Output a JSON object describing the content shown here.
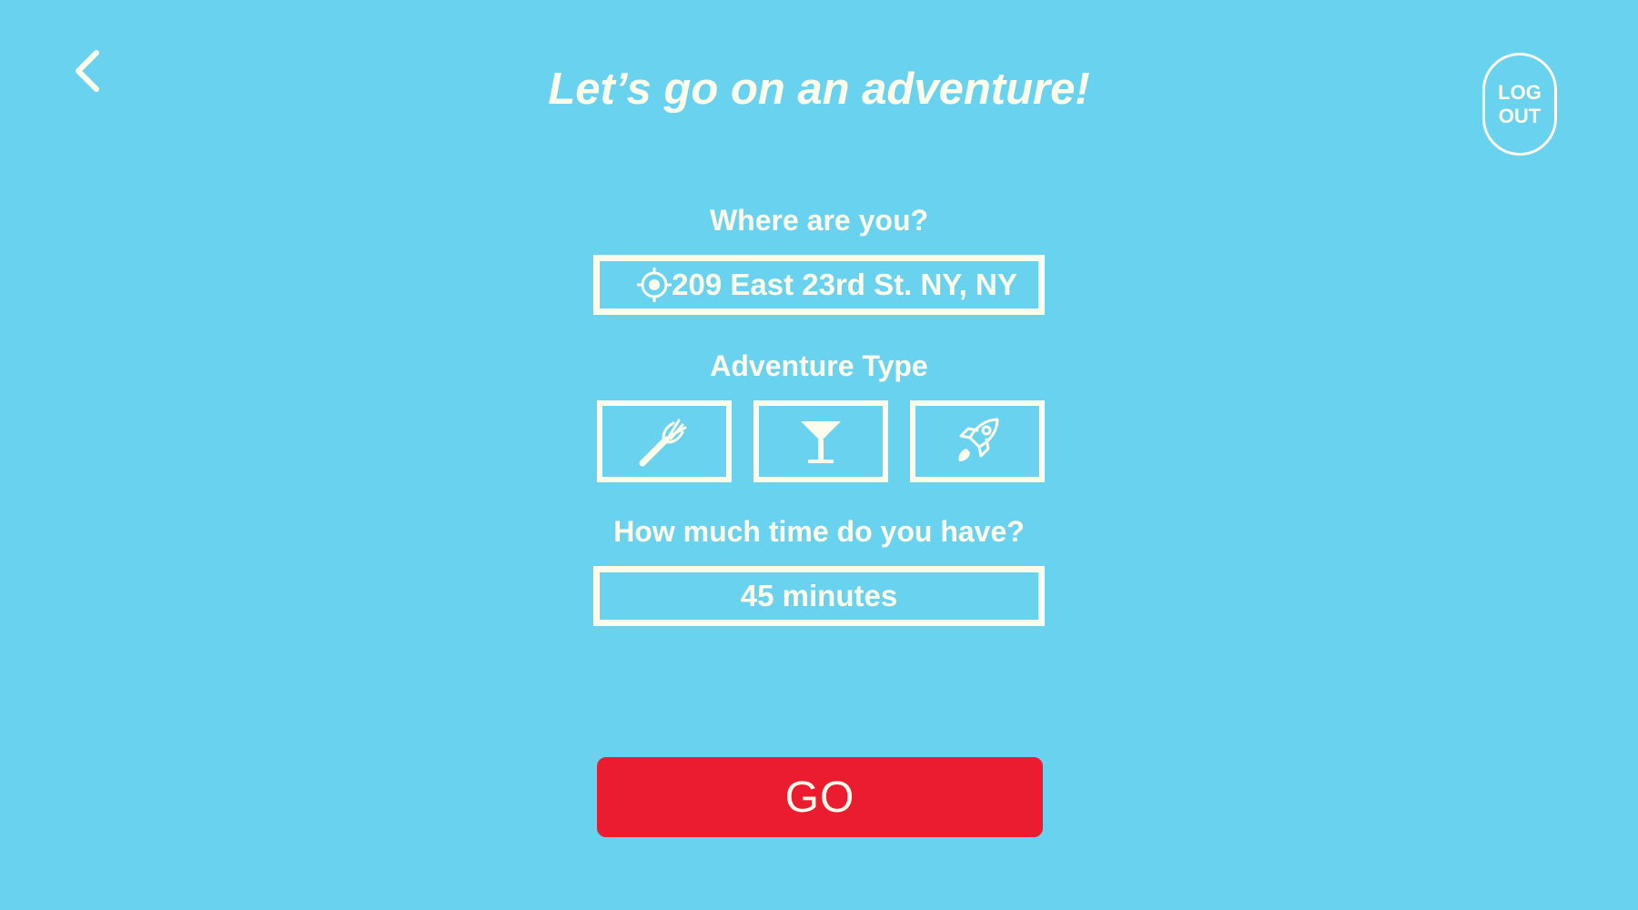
{
  "header": {
    "title": "Let’s go on an adventure!",
    "back_icon": "chevron-left-icon",
    "logout_line1": "LOG",
    "logout_line2": "OUT"
  },
  "location": {
    "label": "Where are you?",
    "value": "209 East 23rd St. NY, NY",
    "icon": "crosshair-location-icon"
  },
  "adventure_type": {
    "label": "Adventure Type",
    "options": [
      {
        "icon": "fork-icon"
      },
      {
        "icon": "martini-glass-icon"
      },
      {
        "icon": "rocket-icon"
      }
    ]
  },
  "time": {
    "label": "How much time do you have?",
    "value": "45 minutes"
  },
  "go_button": {
    "label": "GO"
  },
  "colors": {
    "background": "#69D2EE",
    "foreground": "#FEFCEB",
    "go_button": "#EB1C2F"
  }
}
